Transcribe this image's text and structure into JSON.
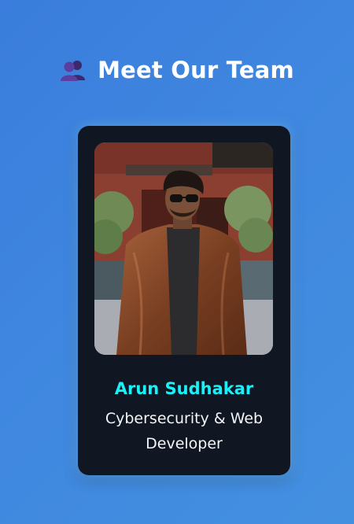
{
  "header": {
    "title": "Meet Our Team",
    "icon": "team-people-icon"
  },
  "team_member": {
    "name": "Arun Sudhakar",
    "role": "Cybersecurity & Web Developer",
    "photo": "profile-photo"
  },
  "colors": {
    "background": "#3f87e0",
    "card": "#101722",
    "name": "#18f1f7",
    "role": "#f3f5f8"
  }
}
